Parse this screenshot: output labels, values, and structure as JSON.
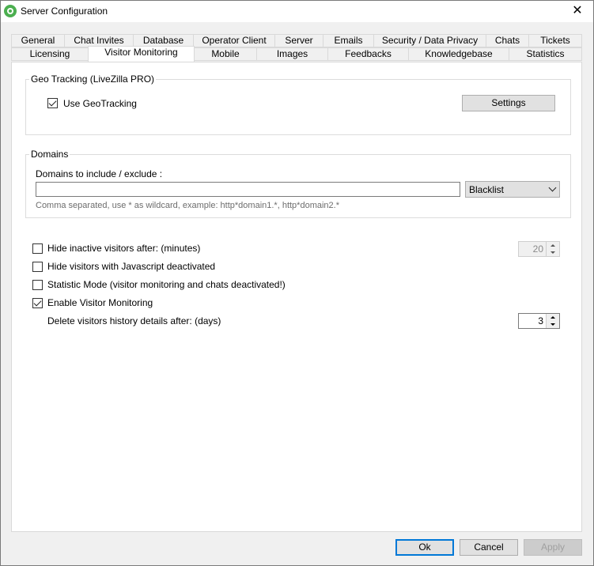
{
  "window": {
    "title": "Server Configuration",
    "close_symbol": "✕"
  },
  "tabs_row1": [
    "General",
    "Chat Invites",
    "Database",
    "Operator Client",
    "Server",
    "Emails",
    "Security / Data Privacy",
    "Chats",
    "Tickets"
  ],
  "tabs_row2": [
    "Licensing",
    "Visitor Monitoring",
    "Mobile",
    "Images",
    "Feedbacks",
    "Knowledgebase",
    "Statistics"
  ],
  "active_tab": "Visitor Monitoring",
  "geo": {
    "legend": "Geo Tracking (LiveZilla PRO)",
    "use_geotracking_label": "Use GeoTracking",
    "use_geotracking_checked": true,
    "settings_button": "Settings"
  },
  "domains": {
    "legend": "Domains",
    "include_label": "Domains to include / exclude :",
    "input_value": "",
    "mode_selected": "Blacklist",
    "hint": "Comma separated, use * as wildcard, example: http*domain1.*, http*domain2.*"
  },
  "options": {
    "hide_inactive_label": "Hide inactive visitors after: (minutes)",
    "hide_inactive_checked": false,
    "hide_inactive_value": "20",
    "hide_js_label": "Hide visitors with Javascript deactivated",
    "hide_js_checked": false,
    "statistic_mode_label": "Statistic Mode (visitor monitoring and chats deactivated!)",
    "statistic_mode_checked": false,
    "enable_monitoring_label": "Enable Visitor Monitoring",
    "enable_monitoring_checked": true,
    "delete_history_label": "Delete visitors history details after: (days)",
    "delete_history_value": "3"
  },
  "footer": {
    "ok": "Ok",
    "cancel": "Cancel",
    "apply": "Apply"
  },
  "colors": {
    "accent": "#0078d7",
    "app_icon": "#4caf50"
  }
}
